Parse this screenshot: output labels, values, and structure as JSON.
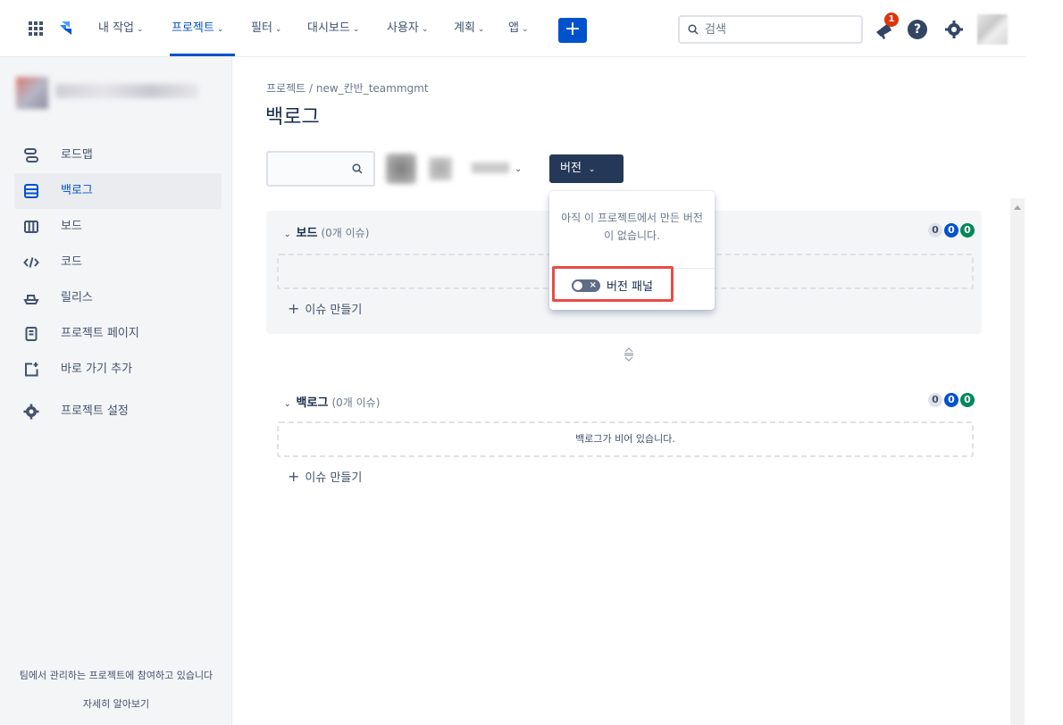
{
  "nav": {
    "items": [
      {
        "label": "내 작업",
        "active": false
      },
      {
        "label": "프로젝트",
        "active": true
      },
      {
        "label": "필터",
        "active": false
      },
      {
        "label": "대시보드",
        "active": false
      },
      {
        "label": "사용자",
        "active": false
      },
      {
        "label": "계획",
        "active": false
      },
      {
        "label": "앱",
        "active": false
      }
    ],
    "create_label": "+",
    "search_placeholder": "검색",
    "notification_count": "1",
    "help_label": "?",
    "accent_color": "#0052cc"
  },
  "sidebar": {
    "items": [
      {
        "label": "로드맵",
        "icon": "roadmap-icon"
      },
      {
        "label": "백로그",
        "icon": "backlog-icon",
        "selected": true
      },
      {
        "label": "보드",
        "icon": "board-icon"
      },
      {
        "label": "코드",
        "icon": "code-icon"
      },
      {
        "label": "릴리스",
        "icon": "ship-icon"
      },
      {
        "label": "프로젝트 페이지",
        "icon": "page-icon"
      },
      {
        "label": "바로 가기 추가",
        "icon": "add-shortcut-icon"
      },
      {
        "label": "프로젝트 설정",
        "icon": "gear-icon"
      }
    ],
    "footer_text": "팀에서 관리하는 프로젝트에 참여하고 있습니다",
    "footer_link": "자세히 알아보기"
  },
  "main": {
    "breadcrumb": "프로젝트 / new_칸반_teammgmt",
    "title": "백로그",
    "version_button": "버전"
  },
  "board_section": {
    "name": "보드",
    "count_text": "(0개 이슈)",
    "counts": [
      "0",
      "0",
      "0"
    ],
    "create_issue": "이슈 만들기"
  },
  "backlog_section": {
    "name": "백로그",
    "count_text": "(0개 이슈)",
    "counts": [
      "0",
      "0",
      "0"
    ],
    "empty_text": "백로그가 비어 있습니다.",
    "create_issue": "이슈 만들기"
  },
  "version_popup": {
    "message": "아직 이 프로젝트에서 만든 버전이 없습니다.",
    "toggle_label": "버전 패널",
    "toggle_on": false
  }
}
